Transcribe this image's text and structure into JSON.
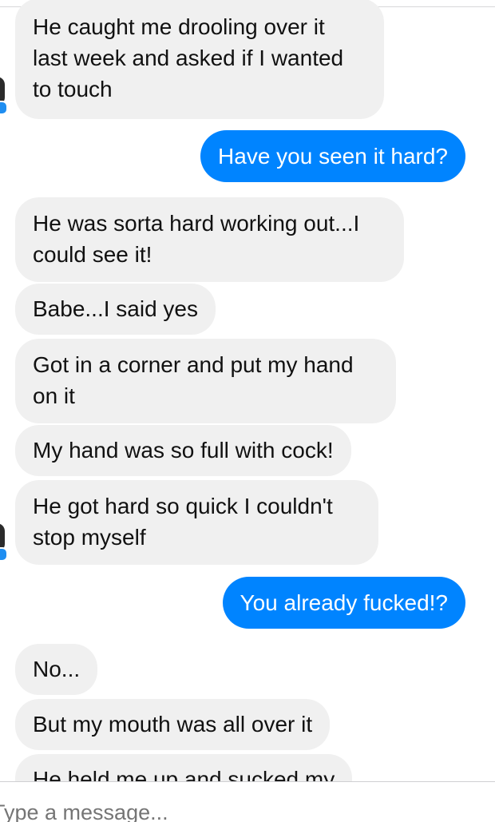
{
  "conversation": {
    "messages": [
      {
        "direction": "incoming",
        "text": "He caught me drooling over it\nlast week and asked if I wanted\nto touch"
      },
      {
        "direction": "outgoing",
        "text": "Have you seen it hard?"
      },
      {
        "direction": "incoming",
        "text": "He was sorta hard working out...I\ncould see it!"
      },
      {
        "direction": "incoming",
        "text": "Babe...I said yes"
      },
      {
        "direction": "incoming",
        "text": "Got in a corner and put my hand\non it"
      },
      {
        "direction": "incoming",
        "text": "My hand was so full with cock!"
      },
      {
        "direction": "incoming",
        "text": "He got hard so quick I couldn't\nstop myself"
      },
      {
        "direction": "outgoing",
        "text": "You already fucked!?"
      },
      {
        "direction": "incoming",
        "text": "No..."
      },
      {
        "direction": "incoming",
        "text": "But my mouth was all over it"
      },
      {
        "direction": "incoming",
        "text": "He held me up and sucked my"
      }
    ]
  },
  "composer": {
    "placeholder": "Type a message..."
  },
  "colors": {
    "outgoing_bubble": "#0084ff",
    "incoming_bubble": "#f0f0f0",
    "online_indicator": "#1f8ef1"
  }
}
